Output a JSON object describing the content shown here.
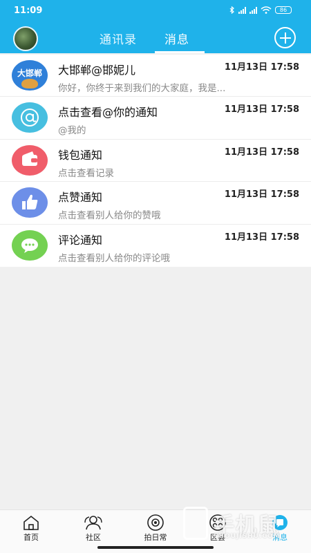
{
  "status_bar": {
    "time": "11:09",
    "battery": "86"
  },
  "header": {
    "tabs": [
      {
        "label": "通讯录",
        "active": false
      },
      {
        "label": "消息",
        "active": true
      }
    ],
    "add_icon": "plus-circle-icon"
  },
  "messages": [
    {
      "icon": "app-logo-icon",
      "logo_text": "大邯郸",
      "title": "大邯郸@邯妮儿",
      "subtitle": "你好，你终于来到我们的大家庭，我是...",
      "date": "11月13日 17:58",
      "color": "#2f80d9"
    },
    {
      "icon": "at-icon",
      "title": "点击查看@你的通知",
      "subtitle": "@我的",
      "date": "11月13日 17:58",
      "color": "#47bfe0"
    },
    {
      "icon": "wallet-icon",
      "title": "钱包通知",
      "subtitle": "点击查看记录",
      "date": "11月13日 17:58",
      "color": "#f05d6a"
    },
    {
      "icon": "thumbs-up-icon",
      "title": "点赞通知",
      "subtitle": "点击查看别人给你的赞哦",
      "date": "11月13日 17:58",
      "color": "#6d8fe8"
    },
    {
      "icon": "comment-icon",
      "title": "评论通知",
      "subtitle": "点击查看别人给你的评论哦",
      "date": "11月13日 17:58",
      "color": "#74d152"
    }
  ],
  "bottom_nav": [
    {
      "label": "首页",
      "icon": "home-icon",
      "active": false
    },
    {
      "label": "社区",
      "icon": "community-icon",
      "active": false
    },
    {
      "label": "拍日常",
      "icon": "camera-icon",
      "active": false
    },
    {
      "label": "区县",
      "icon": "grid-icon",
      "active": false
    },
    {
      "label": "消息",
      "icon": "message-icon",
      "active": true
    }
  ],
  "watermark": {
    "text": "手机鼠",
    "subtext": "SHOUJISHU.COM"
  },
  "colors": {
    "accent": "#1fb2ea",
    "background": "#f0f0f0"
  }
}
